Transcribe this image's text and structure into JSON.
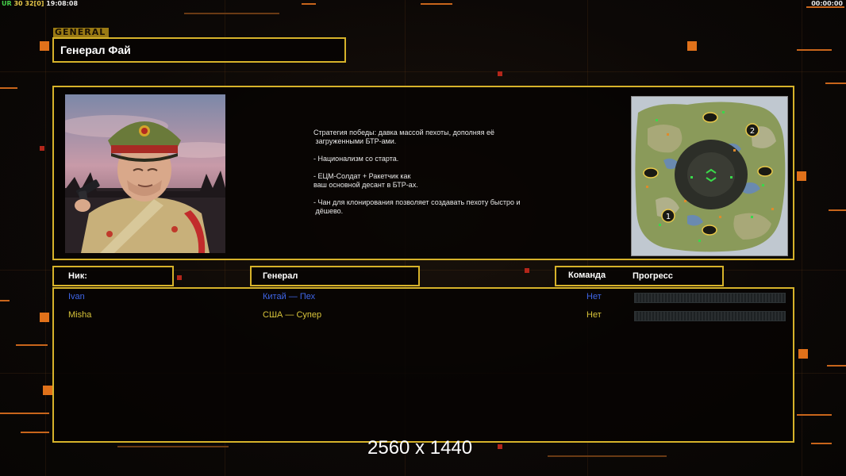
{
  "status_bar": {
    "tag": "UR",
    "fps": "30",
    "frames": "32",
    "frames_extra": "0",
    "clock": "19:08:08",
    "timer": "00:00:00"
  },
  "general_section_tab": "GENERAL",
  "general_name": "Генерал Фай",
  "strategy_text": "Стратегия победы: давка массой пехоты, дополняя её\n загруженными БТР-ами.\n\n- Национализм со старта.\n\n- ЕЦМ-Солдат + Ракетчик как\nваш основной десант в БТР-ах.\n\n- Чан для клонирования позволяет создавать пехоту быстро и\n дёшево.",
  "minimap": {
    "start_markers": [
      "1",
      "2"
    ]
  },
  "table_headers": {
    "nick": "Ник:",
    "general": "Генерал",
    "team": "Команда",
    "progress": "Прогресс"
  },
  "players": [
    {
      "nick": "Ivan",
      "general": "Китай — Пех",
      "team": "Нет",
      "color": "#3f66e8",
      "progress": 0
    },
    {
      "nick": "Misha",
      "general": "США — Супер",
      "team": "Нет",
      "color": "#d8c43a",
      "progress": 0
    }
  ],
  "resolution_label": "2560 x 1440",
  "colors": {
    "frame": "#d6b22a",
    "accent_orange": "#e0711a"
  }
}
